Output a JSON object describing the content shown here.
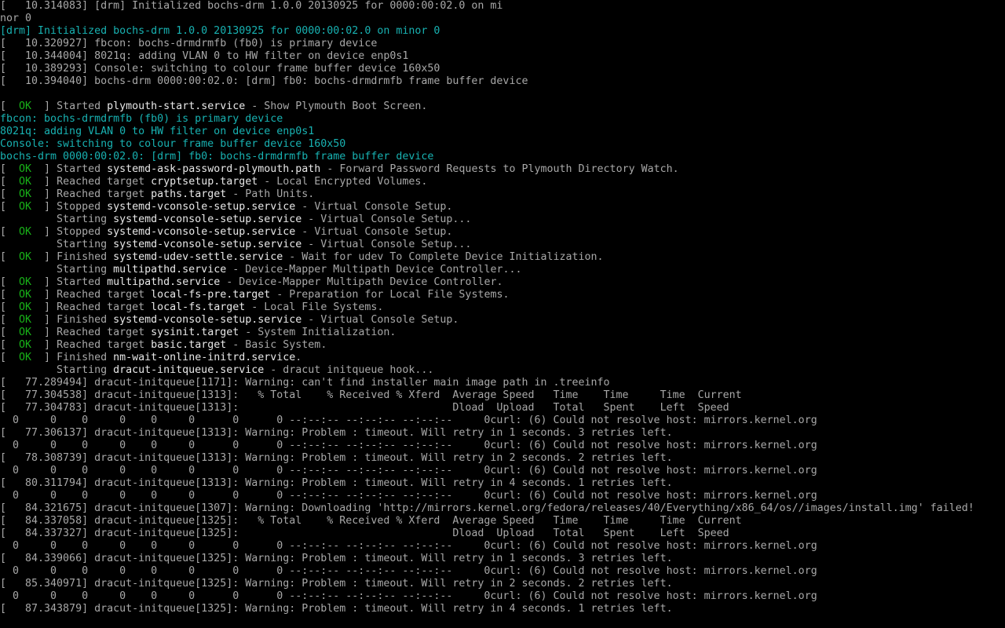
{
  "theme": {
    "background": "#000000",
    "text": "#a8a8a8",
    "highlight": "#e8e8e8",
    "cyan": "#18b2b2",
    "ok_green": "#18b218"
  },
  "lines": [
    [
      {
        "t": "[   10.314083] [drm] Initialized bochs-drm 1.0.0 20130925 for 0000:00:02.0 on mi"
      }
    ],
    [
      {
        "t": "nor 0"
      }
    ],
    [
      {
        "t": "[drm] Initialized bochs-drm 1.0.0 20130925 for 0000:00:02.0 on minor 0",
        "c": "cyan"
      }
    ],
    [
      {
        "t": "[   10.320927] fbcon: bochs-drmdrmfb (fb0) is primary device"
      }
    ],
    [
      {
        "t": "[   10.344004] 8021q: adding VLAN 0 to HW filter on device enp0s1"
      }
    ],
    [
      {
        "t": "[   10.389293] Console: switching to colour frame buffer device 160x50"
      }
    ],
    [
      {
        "t": "[   10.394040] bochs-drm 0000:00:02.0: [drm] fb0: bochs-drmdrmfb frame buffer device"
      }
    ],
    [
      {
        "t": ""
      }
    ],
    [
      {
        "t": "[  "
      },
      {
        "t": "OK",
        "c": "ok"
      },
      {
        "t": "  ] Started "
      },
      {
        "t": "plymouth-start.service",
        "c": "hl"
      },
      {
        "t": " - Show Plymouth Boot Screen."
      }
    ],
    [
      {
        "t": "fbcon: bochs-drmdrmfb (fb0) is primary device",
        "c": "cyan"
      }
    ],
    [
      {
        "t": "8021q: adding VLAN 0 to HW filter on device enp0s1",
        "c": "cyan"
      }
    ],
    [
      {
        "t": "Console: switching to colour frame buffer device 160x50",
        "c": "cyan"
      }
    ],
    [
      {
        "t": "bochs-drm 0000:00:02.0: [drm] fb0: bochs-drmdrmfb frame buffer device",
        "c": "cyan"
      }
    ],
    [
      {
        "t": "[  "
      },
      {
        "t": "OK",
        "c": "ok"
      },
      {
        "t": "  ] Started "
      },
      {
        "t": "systemd-ask-password-plymouth.path",
        "c": "hl"
      },
      {
        "t": " - Forward Password Requests to Plymouth Directory Watch."
      }
    ],
    [
      {
        "t": "[  "
      },
      {
        "t": "OK",
        "c": "ok"
      },
      {
        "t": "  ] Reached target "
      },
      {
        "t": "cryptsetup.target",
        "c": "hl"
      },
      {
        "t": " - Local Encrypted Volumes."
      }
    ],
    [
      {
        "t": "[  "
      },
      {
        "t": "OK",
        "c": "ok"
      },
      {
        "t": "  ] Reached target "
      },
      {
        "t": "paths.target",
        "c": "hl"
      },
      {
        "t": " - Path Units."
      }
    ],
    [
      {
        "t": "[  "
      },
      {
        "t": "OK",
        "c": "ok"
      },
      {
        "t": "  ] Stopped "
      },
      {
        "t": "systemd-vconsole-setup.service",
        "c": "hl"
      },
      {
        "t": " - Virtual Console Setup."
      }
    ],
    [
      {
        "t": "         Starting "
      },
      {
        "t": "systemd-vconsole-setup.service",
        "c": "hl"
      },
      {
        "t": " - Virtual Console Setup..."
      }
    ],
    [
      {
        "t": "[  "
      },
      {
        "t": "OK",
        "c": "ok"
      },
      {
        "t": "  ] Stopped "
      },
      {
        "t": "systemd-vconsole-setup.service",
        "c": "hl"
      },
      {
        "t": " - Virtual Console Setup."
      }
    ],
    [
      {
        "t": "         Starting "
      },
      {
        "t": "systemd-vconsole-setup.service",
        "c": "hl"
      },
      {
        "t": " - Virtual Console Setup..."
      }
    ],
    [
      {
        "t": "[  "
      },
      {
        "t": "OK",
        "c": "ok"
      },
      {
        "t": "  ] Finished "
      },
      {
        "t": "systemd-udev-settle.service",
        "c": "hl"
      },
      {
        "t": " - Wait for udev To Complete Device Initialization."
      }
    ],
    [
      {
        "t": "         Starting "
      },
      {
        "t": "multipathd.service",
        "c": "hl"
      },
      {
        "t": " - Device-Mapper Multipath Device Controller..."
      }
    ],
    [
      {
        "t": "[  "
      },
      {
        "t": "OK",
        "c": "ok"
      },
      {
        "t": "  ] Started "
      },
      {
        "t": "multipathd.service",
        "c": "hl"
      },
      {
        "t": " - Device-Mapper Multipath Device Controller."
      }
    ],
    [
      {
        "t": "[  "
      },
      {
        "t": "OK",
        "c": "ok"
      },
      {
        "t": "  ] Reached target "
      },
      {
        "t": "local-fs-pre.target",
        "c": "hl"
      },
      {
        "t": " - Preparation for Local File Systems."
      }
    ],
    [
      {
        "t": "[  "
      },
      {
        "t": "OK",
        "c": "ok"
      },
      {
        "t": "  ] Reached target "
      },
      {
        "t": "local-fs.target",
        "c": "hl"
      },
      {
        "t": " - Local File Systems."
      }
    ],
    [
      {
        "t": "[  "
      },
      {
        "t": "OK",
        "c": "ok"
      },
      {
        "t": "  ] Finished "
      },
      {
        "t": "systemd-vconsole-setup.service",
        "c": "hl"
      },
      {
        "t": " - Virtual Console Setup."
      }
    ],
    [
      {
        "t": "[  "
      },
      {
        "t": "OK",
        "c": "ok"
      },
      {
        "t": "  ] Reached target "
      },
      {
        "t": "sysinit.target",
        "c": "hl"
      },
      {
        "t": " - System Initialization."
      }
    ],
    [
      {
        "t": "[  "
      },
      {
        "t": "OK",
        "c": "ok"
      },
      {
        "t": "  ] Reached target "
      },
      {
        "t": "basic.target",
        "c": "hl"
      },
      {
        "t": " - Basic System."
      }
    ],
    [
      {
        "t": "[  "
      },
      {
        "t": "OK",
        "c": "ok"
      },
      {
        "t": "  ] Finished "
      },
      {
        "t": "nm-wait-online-initrd.service",
        "c": "hl"
      },
      {
        "t": "."
      }
    ],
    [
      {
        "t": "         Starting "
      },
      {
        "t": "dracut-initqueue.service",
        "c": "hl"
      },
      {
        "t": " - dracut initqueue hook..."
      }
    ],
    [
      {
        "t": "[   77.289494] dracut-initqueue[1171]: Warning: can't find installer main image path in .treeinfo"
      }
    ],
    [
      {
        "t": "[   77.304538] dracut-initqueue[1313]:   % Total    % Received % Xferd  Average Speed   Time    Time     Time  Current"
      }
    ],
    [
      {
        "t": "[   77.304783] dracut-initqueue[1313]:                                  Dload  Upload   Total   Spent    Left  Speed"
      }
    ],
    [
      {
        "t": "  0     0    0     0    0     0      0      0 --:--:-- --:--:-- --:--:--     0curl: (6) Could not resolve host: mirrors.kernel.org"
      }
    ],
    [
      {
        "t": "[   77.306137] dracut-initqueue[1313]: Warning: Problem : timeout. Will retry in 1 seconds. 3 retries left."
      }
    ],
    [
      {
        "t": "  0     0    0     0    0     0      0      0 --:--:-- --:--:-- --:--:--     0curl: (6) Could not resolve host: mirrors.kernel.org"
      }
    ],
    [
      {
        "t": "[   78.308739] dracut-initqueue[1313]: Warning: Problem : timeout. Will retry in 2 seconds. 2 retries left."
      }
    ],
    [
      {
        "t": "  0     0    0     0    0     0      0      0 --:--:-- --:--:-- --:--:--     0curl: (6) Could not resolve host: mirrors.kernel.org"
      }
    ],
    [
      {
        "t": "[   80.311794] dracut-initqueue[1313]: Warning: Problem : timeout. Will retry in 4 seconds. 1 retries left."
      }
    ],
    [
      {
        "t": "  0     0    0     0    0     0      0      0 --:--:-- --:--:-- --:--:--     0curl: (6) Could not resolve host: mirrors.kernel.org"
      }
    ],
    [
      {
        "t": "[   84.321675] dracut-initqueue[1307]: Warning: Downloading 'http://mirrors.kernel.org/fedora/releases/40/Everything/x86_64/os//images/install.img' failed!"
      }
    ],
    [
      {
        "t": "[   84.337058] dracut-initqueue[1325]:   % Total    % Received % Xferd  Average Speed   Time    Time     Time  Current"
      }
    ],
    [
      {
        "t": "[   84.337327] dracut-initqueue[1325]:                                  Dload  Upload   Total   Spent    Left  Speed"
      }
    ],
    [
      {
        "t": "  0     0    0     0    0     0      0      0 --:--:-- --:--:-- --:--:--     0curl: (6) Could not resolve host: mirrors.kernel.org"
      }
    ],
    [
      {
        "t": "[   84.339066] dracut-initqueue[1325]: Warning: Problem : timeout. Will retry in 1 seconds. 3 retries left."
      }
    ],
    [
      {
        "t": "  0     0    0     0    0     0      0      0 --:--:-- --:--:-- --:--:--     0curl: (6) Could not resolve host: mirrors.kernel.org"
      }
    ],
    [
      {
        "t": "[   85.340971] dracut-initqueue[1325]: Warning: Problem : timeout. Will retry in 2 seconds. 2 retries left."
      }
    ],
    [
      {
        "t": "  0     0    0     0    0     0      0      0 --:--:-- --:--:-- --:--:--     0curl: (6) Could not resolve host: mirrors.kernel.org"
      }
    ],
    [
      {
        "t": "[   87.343879] dracut-initqueue[1325]: Warning: Problem : timeout. Will retry in 4 seconds. 1 retries left."
      }
    ]
  ]
}
